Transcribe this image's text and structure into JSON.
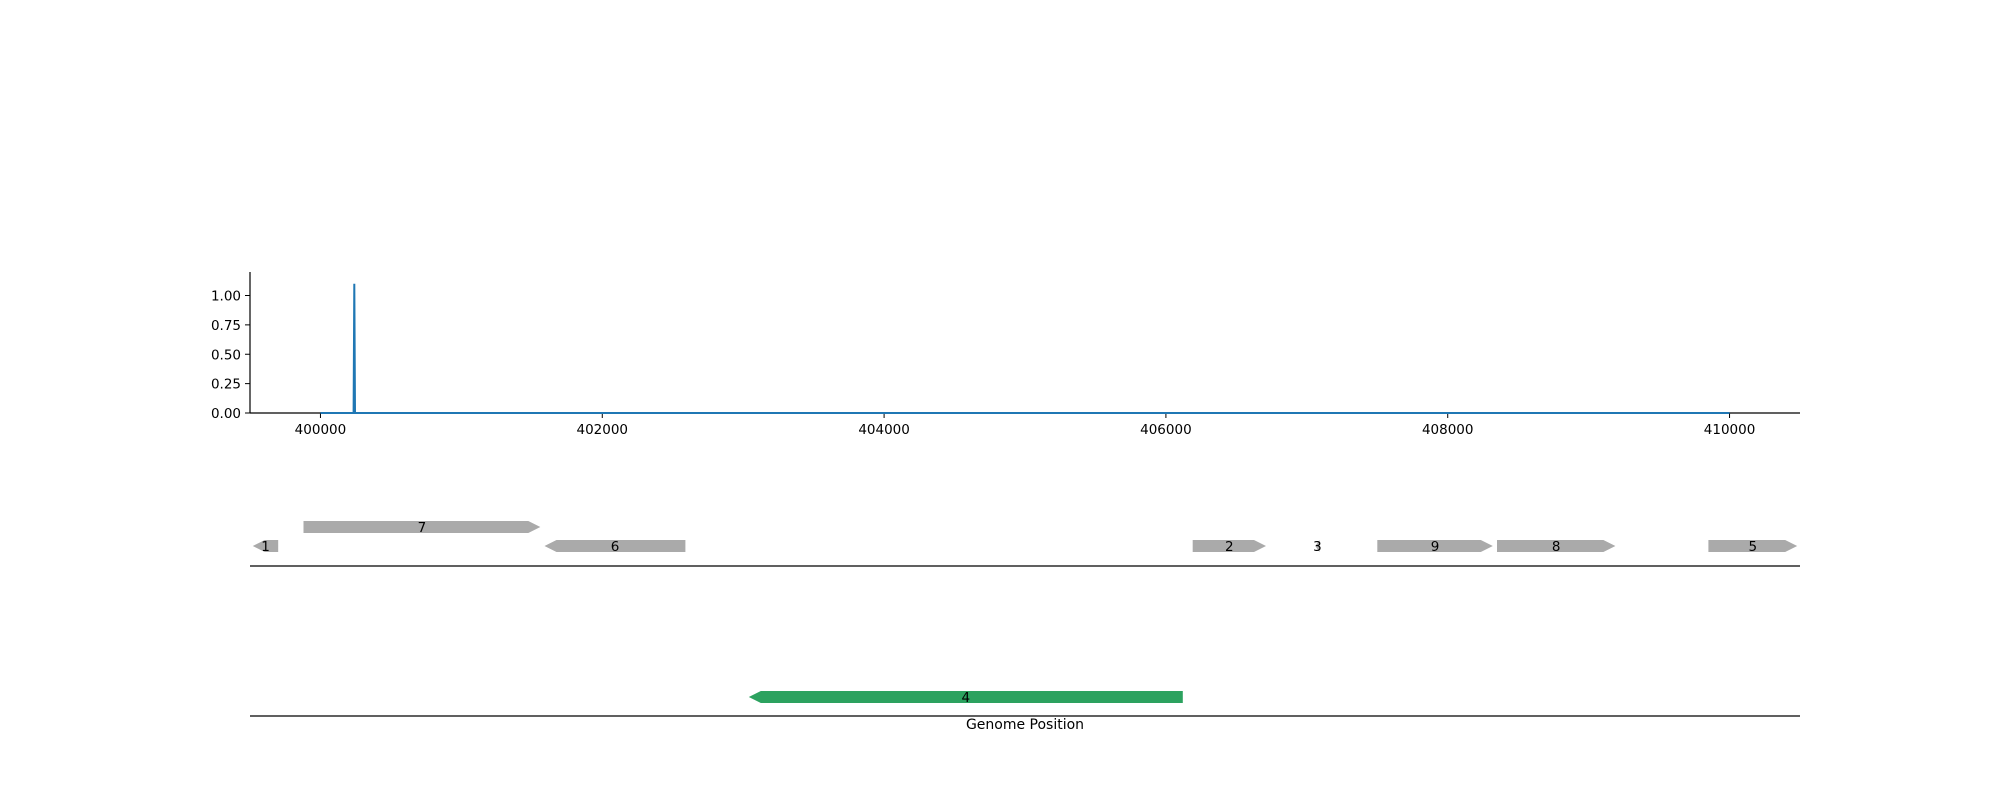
{
  "chart_data": [
    {
      "type": "line",
      "xlim": [
        399500,
        410500
      ],
      "ylim": [
        0,
        1.2
      ],
      "x_ticks": [
        400000,
        402000,
        404000,
        406000,
        408000,
        410000
      ],
      "y_ticks": [
        0.0,
        0.25,
        0.5,
        0.75,
        1.0
      ],
      "x_tick_labels": [
        "400000",
        "402000",
        "404000",
        "406000",
        "408000",
        "410000"
      ],
      "y_tick_labels": [
        "0.00",
        "0.25",
        "0.50",
        "0.75",
        "1.00"
      ],
      "series": [
        {
          "color": "#1f77b4",
          "x": [
            400000,
            400235,
            400240,
            400245,
            410000
          ],
          "y": [
            0,
            0,
            1.1,
            0,
            0
          ]
        }
      ],
      "grid": false
    },
    {
      "type": "gene_track",
      "xlim": [
        399500,
        410500
      ],
      "genes": [
        {
          "label": "1",
          "start": 399520,
          "end": 399700,
          "strand": "-",
          "color": "#aaaaaa",
          "row": 0
        },
        {
          "label": "7",
          "start": 399880,
          "end": 401560,
          "strand": "+",
          "color": "#aaaaaa",
          "row": 1
        },
        {
          "label": "6",
          "start": 401590,
          "end": 402590,
          "strand": "-",
          "color": "#aaaaaa",
          "row": 0
        },
        {
          "label": "2",
          "start": 406190,
          "end": 406710,
          "strand": "+",
          "color": "#aaaaaa",
          "row": 0
        },
        {
          "label": "3",
          "start": 407060,
          "end": 407090,
          "strand": "-",
          "color": "#aaaaaa",
          "row": 0
        },
        {
          "label": "9",
          "start": 407500,
          "end": 408320,
          "strand": "+",
          "color": "#aaaaaa",
          "row": 0
        },
        {
          "label": "8",
          "start": 408350,
          "end": 409190,
          "strand": "+",
          "color": "#aaaaaa",
          "row": 0
        },
        {
          "label": "5",
          "start": 409850,
          "end": 410480,
          "strand": "+",
          "color": "#aaaaaa",
          "row": 0
        }
      ]
    },
    {
      "type": "gene_track",
      "xlim": [
        399500,
        410500
      ],
      "xlabel": "Genome Position",
      "genes": [
        {
          "label": "4",
          "start": 403040,
          "end": 406120,
          "strand": "-",
          "color": "#2ca25f",
          "row": 0
        }
      ]
    }
  ]
}
